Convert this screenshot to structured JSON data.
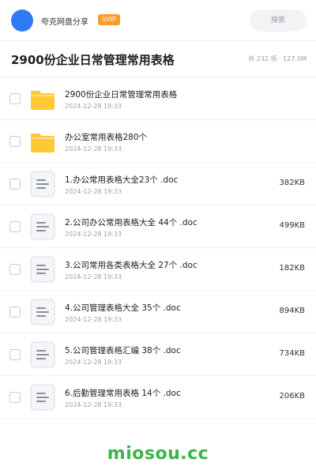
{
  "header": {
    "sharer_name": "夸克网盘分享",
    "badge": "SVIP",
    "search_label": "搜索"
  },
  "folder": {
    "title": "2900份企业日常管理常用表格",
    "meta": "共 232 项 · 127.0M"
  },
  "items": [
    {
      "type": "folder",
      "name": "2900份企业日常管理常用表格",
      "date": "2024-12-28 19:33",
      "size": ""
    },
    {
      "type": "folder",
      "name": "办公室常用表格280个",
      "date": "2024-12-28 19:33",
      "size": ""
    },
    {
      "type": "doc",
      "name": "1.办公常用表格大全23个 .doc",
      "date": "2024-12-28 19:33",
      "size": "382KB"
    },
    {
      "type": "doc",
      "name": "2.公司办公常用表格大全 44个 .doc",
      "date": "2024-12-28 19:33",
      "size": "499KB"
    },
    {
      "type": "doc",
      "name": "3.公司常用各类表格大全 27个 .doc",
      "date": "2024-12-28 19:33",
      "size": "182KB"
    },
    {
      "type": "doc",
      "name": "4.公司管理表格大全 35个 .doc",
      "date": "2024-12-28 19:33",
      "size": "894KB"
    },
    {
      "type": "doc",
      "name": "5.公司管理表格汇编 38个 .doc",
      "date": "2024-12-28 19:33",
      "size": "734KB"
    },
    {
      "type": "doc",
      "name": "6.后勤管理常用表格 14个 .doc",
      "date": "2024-12-28 19:33",
      "size": "206KB"
    }
  ],
  "watermark": "miosou.cc",
  "colors": {
    "avatar": "#2f7bf6",
    "badge": "#ff9a2e",
    "folder_icon": "#ffc933",
    "watermark": "#3ab54a"
  }
}
